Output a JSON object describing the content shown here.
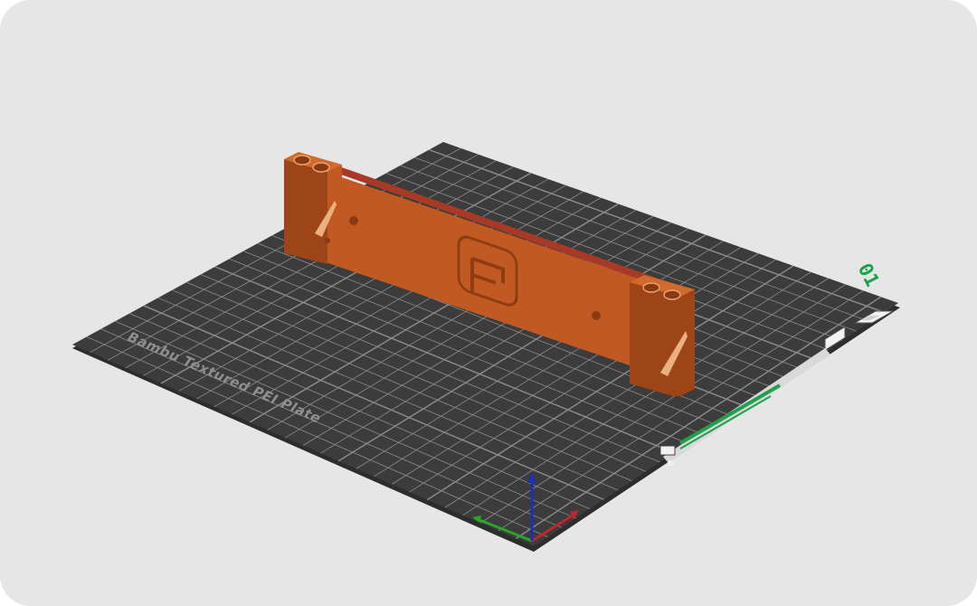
{
  "viewport": {
    "background_color": "#e6e6e6"
  },
  "plate": {
    "name": "Bambu Textured PEI Plate",
    "number": "01",
    "surface_color": "#3b3c3b",
    "edge_color": "#2c2d2c",
    "grid_color": "#8d8e8d",
    "label_color": "#8f8f8f",
    "number_color": "#16a34a"
  },
  "model": {
    "color_front": "#c05a22",
    "color_top": "#d26a2c",
    "color_back": "#a63a26",
    "color_side": "#9e4517",
    "logo_icon": "f-logo-icon"
  },
  "axes": {
    "x_color": "#c0262d",
    "y_color": "#2aa52a",
    "z_color": "#1c2fb8"
  },
  "icons": {
    "toolbar": [
      "eject-icon",
      "label-icon"
    ],
    "badge": "plate-settings-icon"
  },
  "badge": {
    "bar_color": "#20a04a",
    "panel_color": "#d9d9d9"
  }
}
